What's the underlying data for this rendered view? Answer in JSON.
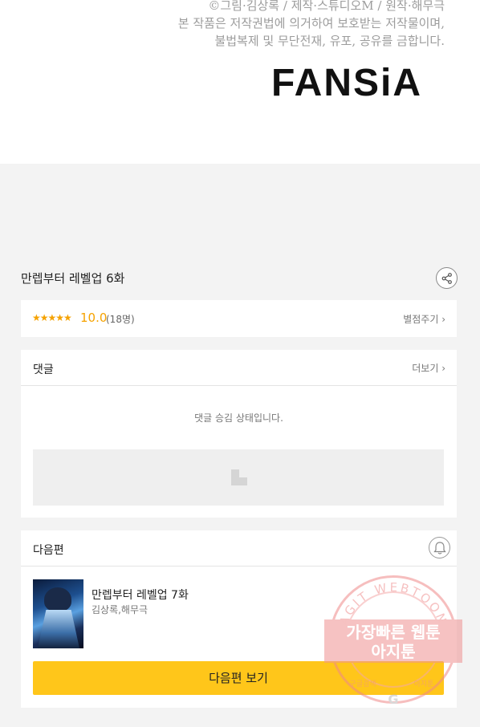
{
  "header": {
    "copyright_lines": [
      "©그림·김상록 / 제작·스튜디오M / 원작·해무극",
      "본 작품은 저작권법에 의거하여 보호받는 저작물이며,",
      "불법복제 및 무단전재, 유포, 공유를 금합니다."
    ],
    "logo": "FANSiA"
  },
  "episode": {
    "title": "만렙부터 레벨업 6화",
    "share_icon": "share-icon"
  },
  "rating": {
    "stars": "★★★★★",
    "score": "10.0",
    "count": "(18명)",
    "rate_label": "별점주기 ›",
    "star_color": "#f5a200"
  },
  "comments": {
    "title": "댓글",
    "more_label": "더보기 ›",
    "approval_text": "댓글 승김 상태입니다."
  },
  "next_episode": {
    "section_title": "다음편",
    "title": "만렙부터 레벨업 7화",
    "author": "김상록,해무극",
    "button_label": "다음편 보기",
    "button_color": "#ffc61a",
    "bell_icon": "bell-icon"
  },
  "watermark": {
    "ring_text": "AGIT WEBTOON",
    "line1": "가장빠른 웹툰",
    "line2": "아지툰",
    "bottom_left": "구글검색",
    "bottom_right": "아지툰",
    "color": "#ef8f8f"
  }
}
